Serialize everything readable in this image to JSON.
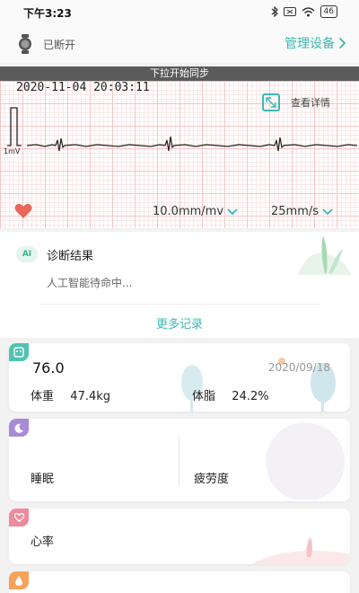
{
  "status_bar": {
    "time": "下午3:23",
    "battery": "46"
  },
  "device": {
    "status": "已断开",
    "manage_label": "管理设备"
  },
  "sync_banner": "下拉开始同步",
  "ecg": {
    "datetime": "2020-11-04 20:03:11",
    "detail_label": "查看详情",
    "calibration_label": "1mV",
    "gain": "10.0mm/mv",
    "paper_speed": "25mm/s"
  },
  "diagnosis": {
    "badge": "AI",
    "title": "诊断结果",
    "text": "人工智能待命中...",
    "more_label": "更多记录"
  },
  "weight_card": {
    "score": "76.0",
    "date": "2020/09/18",
    "weight_label": "体重",
    "weight_value": "47.4kg",
    "fat_label": "体脂",
    "fat_value": "24.2%"
  },
  "sleep_card": {
    "sleep_label": "睡眠",
    "fatigue_label": "疲劳度"
  },
  "heart_card": {
    "label": "心率"
  },
  "colors": {
    "accent": "#3cb8b0",
    "weight_tab": "#4fc3b0",
    "sleep_tab": "#a98ad8",
    "heart_tab": "#f08a9b",
    "last_tab": "#f5a35a",
    "heart_icon": "#e8675c"
  },
  "icons": {
    "watch": "watch-icon",
    "manage_arrow": "chevron-right-icon",
    "detail": "expand-icon",
    "heart": "heart-icon",
    "dropdown": "chevron-down-icon",
    "weight": "scale-icon",
    "sleep": "moon-icon",
    "heart_rate": "heart-icon",
    "last": "drop-icon"
  }
}
